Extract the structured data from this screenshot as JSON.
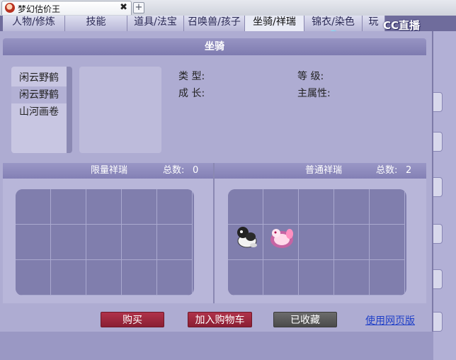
{
  "browser": {
    "tab_title": "梦幻估价王",
    "close_glyph": "✖",
    "new_tab_glyph": "+"
  },
  "game_tabs": [
    "人物/修炼",
    "技能",
    "道具/法宝",
    "召唤兽/孩子",
    "坐骑/祥瑞",
    "锦衣/染色",
    "玩"
  ],
  "active_tab": "坐骑/祥瑞",
  "overlay_logo": "CC直播",
  "panel": {
    "title": "坐骑",
    "mounts": [
      "闲云野鹤",
      "闲云野鹤",
      "山河画卷"
    ],
    "attributes": {
      "type_label": "类   型:",
      "level_label": "等   级:",
      "growth_label": "成   长:",
      "main_attr_label": "主属性:"
    }
  },
  "limited": {
    "title": "限量祥瑞",
    "count_label": "总数:",
    "count": "0"
  },
  "normal": {
    "title": "普通祥瑞",
    "count_label": "总数:",
    "count": "2",
    "items": [
      "black-white-pet-icon",
      "pink-glow-pet-icon"
    ]
  },
  "buttons": {
    "buy": "购买",
    "add_cart": "加入购物车",
    "collected": "已收藏",
    "web_link": "使用网页版"
  },
  "colors": {
    "panel_bg": "#aeacd2",
    "header_bg": "#8a87bb",
    "button_red": "#9e2a40",
    "button_gray": "#5a5a5a",
    "link": "#1f3fc8"
  }
}
